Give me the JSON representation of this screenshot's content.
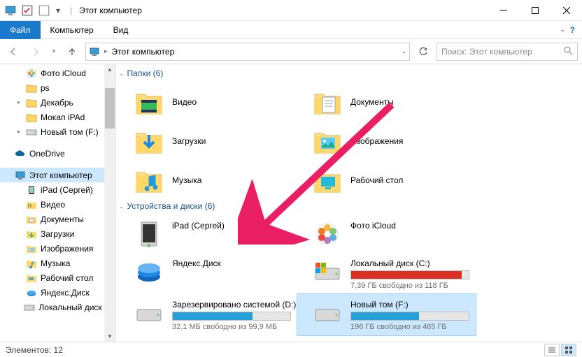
{
  "title": "Этот компьютер",
  "ribbon": {
    "file": "Файл",
    "tabs": [
      "Компьютер",
      "Вид"
    ]
  },
  "address": {
    "root": "Этот компьютер"
  },
  "search": {
    "placeholder": "Поиск: Этот компьютер"
  },
  "sidebar": {
    "items": [
      {
        "label": "Фото iCloud",
        "icon": "photos",
        "indent": true
      },
      {
        "label": "ps",
        "icon": "folder",
        "indent": true
      },
      {
        "label": "Декабрь",
        "icon": "folder",
        "indent": true,
        "exp": true
      },
      {
        "label": "Мокап iPAd",
        "icon": "folder",
        "indent": true
      },
      {
        "label": "Новый том (F:)",
        "icon": "drive",
        "indent": true,
        "exp": true
      },
      {
        "label": "OneDrive",
        "icon": "onedrive",
        "indent": false,
        "spaced": true
      },
      {
        "label": "Этот компьютер",
        "icon": "pc",
        "indent": false,
        "selected": true,
        "spaced": true
      },
      {
        "label": "iPad (Сергей)",
        "icon": "ipad",
        "indent": true
      },
      {
        "label": "Видео",
        "icon": "video",
        "indent": true
      },
      {
        "label": "Документы",
        "icon": "docs",
        "indent": true
      },
      {
        "label": "Загрузки",
        "icon": "downloads",
        "indent": true
      },
      {
        "label": "Изображения",
        "icon": "pictures",
        "indent": true
      },
      {
        "label": "Музыка",
        "icon": "music",
        "indent": true
      },
      {
        "label": "Рабочий стол",
        "icon": "desktop",
        "indent": true
      },
      {
        "label": "Яндекс.Диск",
        "icon": "yadisk",
        "indent": true
      },
      {
        "label": "Локальный диск (…",
        "icon": "drive",
        "indent": true
      }
    ]
  },
  "groups": {
    "folders": {
      "title": "Папки",
      "count": 6
    },
    "devices": {
      "title": "Устройства и диски",
      "count": 6
    }
  },
  "folders": [
    {
      "name": "Видео",
      "icon": "video"
    },
    {
      "name": "Документы",
      "icon": "docs"
    },
    {
      "name": "Загрузки",
      "icon": "downloads"
    },
    {
      "name": "Изображения",
      "icon": "pictures"
    },
    {
      "name": "Музыка",
      "icon": "music"
    },
    {
      "name": "Рабочий стол",
      "icon": "desktop"
    }
  ],
  "devices": [
    {
      "name": "iPad (Сергей)",
      "icon": "ipad-device"
    },
    {
      "name": "Фото iCloud",
      "icon": "photos-big"
    },
    {
      "name": "Яндекс.Диск",
      "icon": "yadisk-big"
    },
    {
      "name": "Локальный диск (C:)",
      "icon": "drive-c",
      "bar_pct": 94,
      "bar_color": "#d93025",
      "sub": "7,39 ГБ свободно из 118 ГБ"
    },
    {
      "name": "Зарезервировано системой (D:)",
      "icon": "drive-gen",
      "bar_pct": 68,
      "bar_color": "#26a0da",
      "sub": "32,1 МБ свободно из 99,9 МБ"
    },
    {
      "name": "Новый том (F:)",
      "icon": "drive-gen",
      "bar_pct": 58,
      "bar_color": "#26a0da",
      "sub": "196 ГБ свободно из 465 ГБ",
      "selected": true
    }
  ],
  "status": {
    "items_label": "Элементов:",
    "count": 12
  }
}
